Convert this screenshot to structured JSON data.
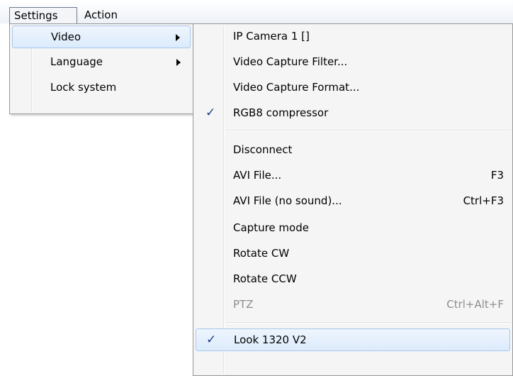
{
  "menubar": {
    "settings_label": "Settings",
    "action_label": "Action"
  },
  "settings_menu": {
    "video_label": "Video",
    "language_label": "Language",
    "lock_system_label": "Lock system"
  },
  "video_menu": {
    "ip_camera_label": "IP Camera 1 []",
    "capture_filter_label": "Video Capture Filter...",
    "capture_format_label": "Video Capture Format...",
    "rgb8_label": "RGB8 compressor",
    "disconnect_label": "Disconnect",
    "avi_file_label": "AVI File...",
    "avi_file_shortcut": "F3",
    "avi_nosound_label": "AVI File (no sound)...",
    "avi_nosound_shortcut": "Ctrl+F3",
    "capture_mode_label": "Capture mode",
    "rotate_cw_label": "Rotate CW",
    "rotate_ccw_label": "Rotate CCW",
    "ptz_label": "PTZ",
    "ptz_shortcut": "Ctrl+Alt+F",
    "look_label": "Look 1320 V2",
    "check_glyph": "✓"
  }
}
